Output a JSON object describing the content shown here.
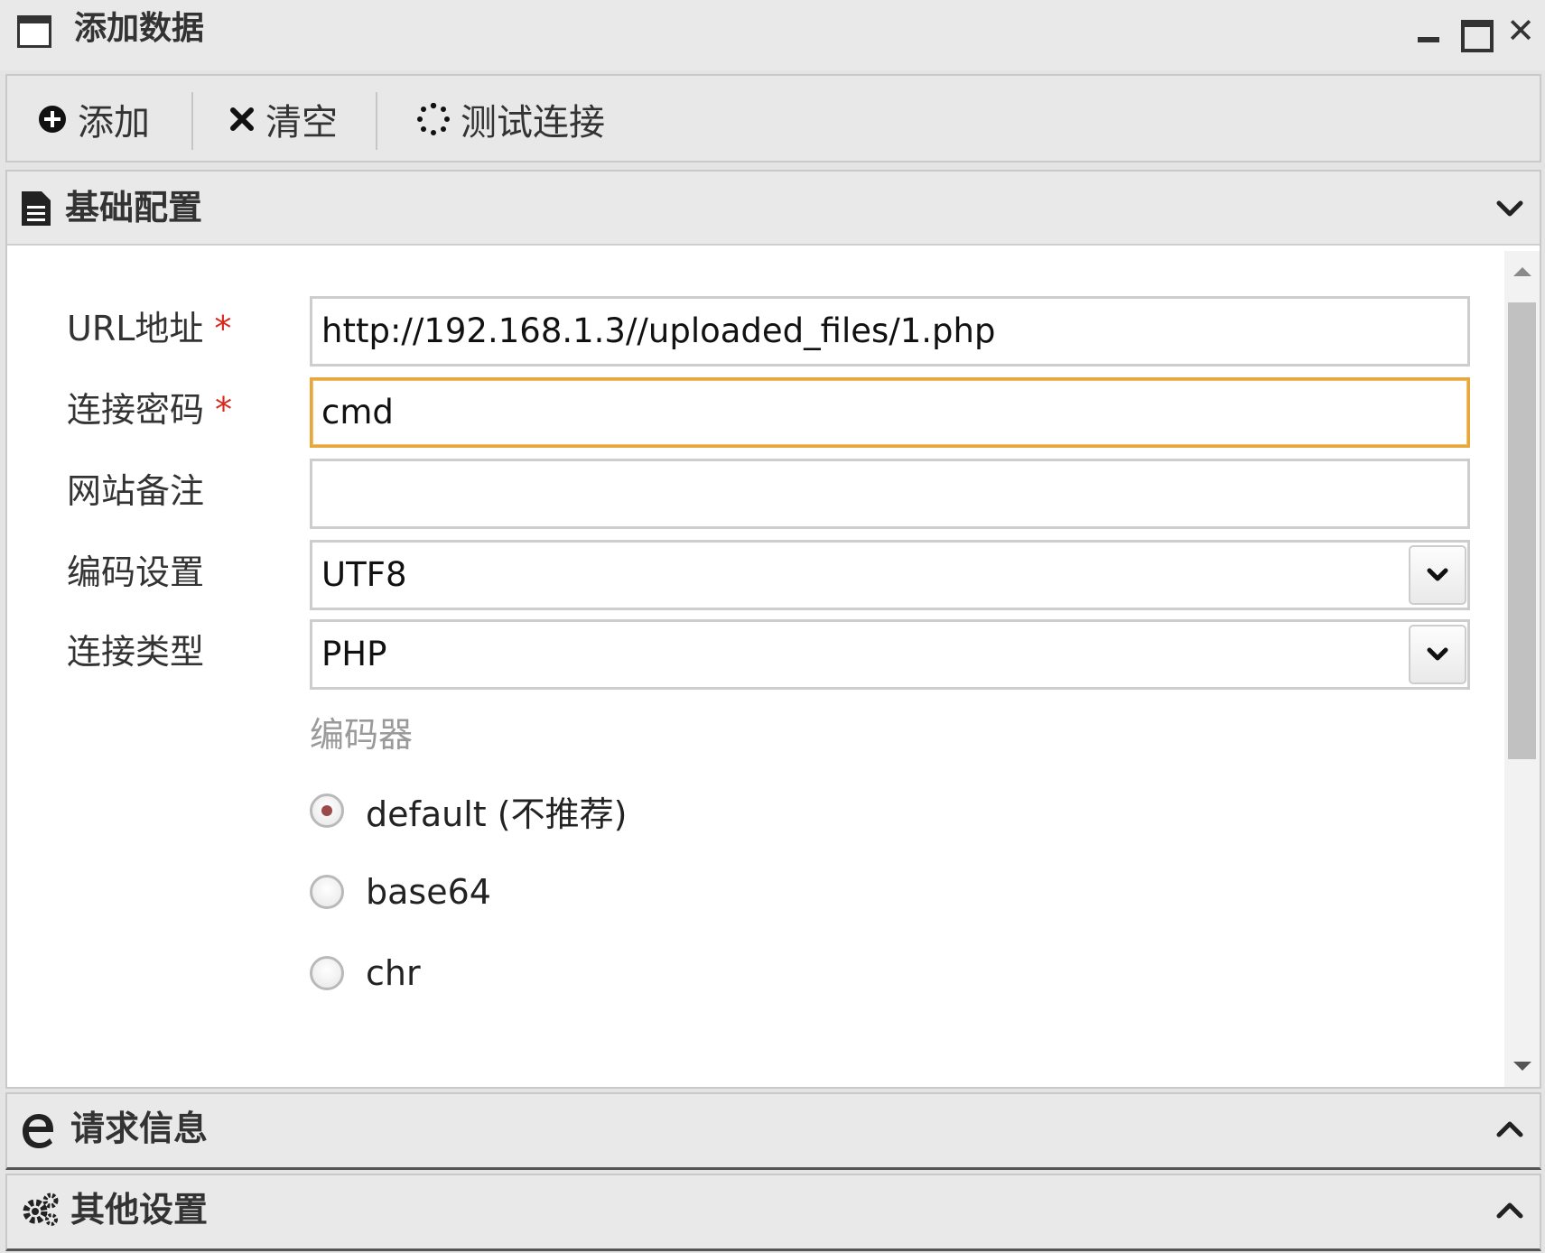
{
  "window": {
    "title": "添加数据"
  },
  "toolbar": {
    "add_label": "添加",
    "clear_label": "清空",
    "test_label": "测试连接"
  },
  "basic": {
    "section_title": "基础配置",
    "url": {
      "label": "URL地址",
      "required_mark": "*",
      "value": "http://192.168.1.3//uploaded_files/1.php"
    },
    "password": {
      "label": "连接密码",
      "required_mark": "*",
      "value": "cmd"
    },
    "note": {
      "label": "网站备注",
      "value": ""
    },
    "encoding": {
      "label": "编码设置",
      "value": "UTF8"
    },
    "type": {
      "label": "连接类型",
      "value": "PHP"
    },
    "encoder": {
      "label": "编码器",
      "options": [
        "default (不推荐)",
        "base64",
        "chr"
      ],
      "selected": "default (不推荐)"
    }
  },
  "request_section": {
    "title": "请求信息"
  },
  "other_section": {
    "title": "其他设置"
  },
  "colors": {
    "focus_border": "#e8a73a",
    "required": "#d9271b",
    "header_bg": "#e9e9e9"
  },
  "icons": [
    "window-icon",
    "minimize-icon",
    "maximize-icon",
    "close-icon",
    "plus-circle-icon",
    "x-icon",
    "spinner-icon",
    "document-icon",
    "chevron-down-icon",
    "ie-icon",
    "gears-icon",
    "chevron-up-icon"
  ]
}
